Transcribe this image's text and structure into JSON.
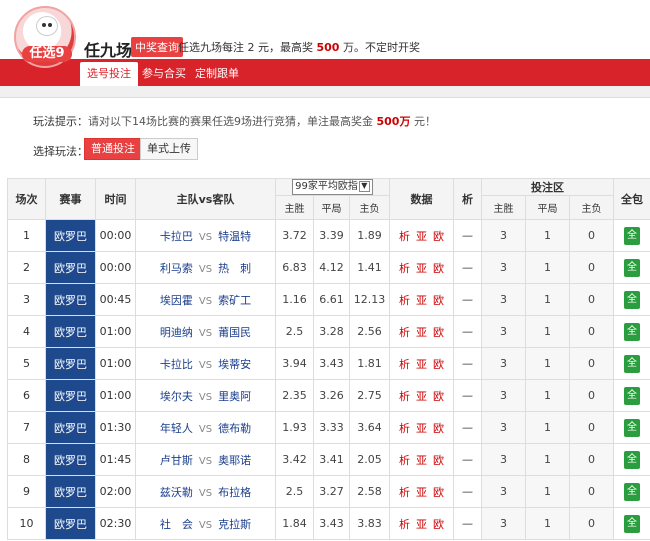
{
  "header": {
    "logo_text": "任选9",
    "title": "任九场",
    "prize_button": "中奖查询",
    "subtitle_pre": "任选九场每注 ",
    "subtitle_bet": "2",
    "subtitle_mid": " 元，最高奖 ",
    "subtitle_max": "500",
    "subtitle_post": " 万。不定时开奖"
  },
  "nav": {
    "tabs": [
      "选号投注",
      "参与合买",
      "定制跟单"
    ]
  },
  "tips": {
    "label": "玩法提示：",
    "text_pre": "请对以下14场比赛的赛果任选9场进行竞猜，单注最高奖金 ",
    "max": "500万",
    "text_post": " 元！"
  },
  "play": {
    "label": "选择玩法：",
    "options": [
      "普通投注",
      "单式上传"
    ]
  },
  "table": {
    "headers": {
      "match_no": "场次",
      "league": "赛事",
      "time": "时间",
      "teams": "主队vs客队",
      "odds_select": "99家平均欧指",
      "data": "数据",
      "analysis": "析",
      "bet_area": "投注区",
      "all": "全包",
      "home_win": "主胜",
      "draw": "平局",
      "away_win": "主负"
    },
    "vs_text": "VS",
    "data_links": [
      "析",
      "亚",
      "欧"
    ],
    "dash": "—",
    "bet_values": [
      "3",
      "1",
      "0"
    ],
    "all_label": "全",
    "rows": [
      {
        "no": "1",
        "league": "欧罗巴",
        "time": "00:00",
        "home": "卡拉巴",
        "away": "特温特",
        "odds": [
          "3.72",
          "3.39",
          "1.89"
        ]
      },
      {
        "no": "2",
        "league": "欧罗巴",
        "time": "00:00",
        "home": "利马索",
        "away": "热　刺",
        "odds": [
          "6.83",
          "4.12",
          "1.41"
        ]
      },
      {
        "no": "3",
        "league": "欧罗巴",
        "time": "00:45",
        "home": "埃因霍",
        "away": "索矿工",
        "odds": [
          "1.16",
          "6.61",
          "12.13"
        ]
      },
      {
        "no": "4",
        "league": "欧罗巴",
        "time": "01:00",
        "home": "明迪纳",
        "away": "莆国民",
        "odds": [
          "2.5",
          "3.28",
          "2.56"
        ]
      },
      {
        "no": "5",
        "league": "欧罗巴",
        "time": "01:00",
        "home": "卡拉比",
        "away": "埃蒂安",
        "odds": [
          "3.94",
          "3.43",
          "1.81"
        ]
      },
      {
        "no": "6",
        "league": "欧罗巴",
        "time": "01:00",
        "home": "埃尔夫",
        "away": "里奥阿",
        "odds": [
          "2.35",
          "3.26",
          "2.75"
        ]
      },
      {
        "no": "7",
        "league": "欧罗巴",
        "time": "01:30",
        "home": "年轻人",
        "away": "德布勒",
        "odds": [
          "1.93",
          "3.33",
          "3.64"
        ]
      },
      {
        "no": "8",
        "league": "欧罗巴",
        "time": "01:45",
        "home": "卢甘斯",
        "away": "奥耶诺",
        "odds": [
          "3.42",
          "3.41",
          "2.05"
        ]
      },
      {
        "no": "9",
        "league": "欧罗巴",
        "time": "02:00",
        "home": "兹沃勒",
        "away": "布拉格",
        "odds": [
          "2.5",
          "3.27",
          "2.58"
        ]
      },
      {
        "no": "10",
        "league": "欧罗巴",
        "time": "02:30",
        "home": "社　会",
        "away": "克拉斯",
        "odds": [
          "1.84",
          "3.43",
          "3.83"
        ]
      }
    ]
  }
}
